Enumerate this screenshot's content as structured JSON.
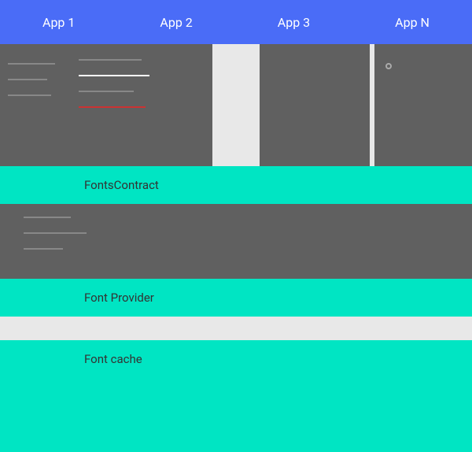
{
  "appBar": {
    "tabs": [
      {
        "label": "App 1"
      },
      {
        "label": "App 2"
      },
      {
        "label": "App 3"
      },
      {
        "label": "App N"
      }
    ]
  },
  "sections": {
    "fontsContract": {
      "label": "FontsContract"
    },
    "fontProvider": {
      "label": "Font Provider"
    },
    "fontCache": {
      "label": "Font cache"
    }
  },
  "colors": {
    "appBarBlue": "#4a6cf7",
    "teal": "#00e5c3",
    "darkGray": "#606060",
    "lightBg": "#e8e8e8"
  }
}
